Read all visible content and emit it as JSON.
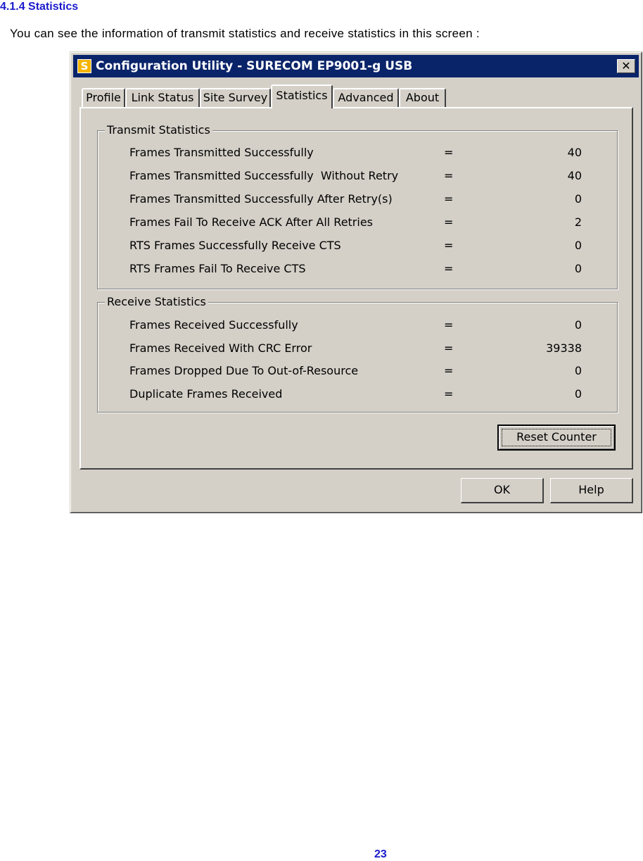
{
  "document": {
    "section_heading": "4.1.4 Statistics",
    "intro": "You can see the information of transmit statistics and receive statistics in this screen :",
    "page_number": "23"
  },
  "window": {
    "title": "Configuration Utility - SURECOM EP9001-g USB",
    "app_icon_glyph": "S",
    "close_glyph": "✕",
    "tabs": [
      {
        "label": "Profile",
        "active": false
      },
      {
        "label": "Link Status",
        "active": false
      },
      {
        "label": "Site Survey",
        "active": false
      },
      {
        "label": "Statistics",
        "active": true
      },
      {
        "label": "Advanced",
        "active": false
      },
      {
        "label": "About",
        "active": false
      }
    ],
    "transmit": {
      "legend": "Transmit Statistics",
      "rows": [
        {
          "label": "Frames Transmitted Successfully",
          "eq": "=",
          "value": "40"
        },
        {
          "label": "Frames Transmitted Successfully  Without Retry",
          "eq": "=",
          "value": "40"
        },
        {
          "label": "Frames Transmitted Successfully After Retry(s)",
          "eq": "=",
          "value": "0"
        },
        {
          "label": "Frames Fail To Receive ACK After All Retries",
          "eq": "=",
          "value": "2"
        },
        {
          "label": "RTS Frames Successfully Receive CTS",
          "eq": "=",
          "value": "0"
        },
        {
          "label": "RTS Frames Fail To Receive CTS",
          "eq": "=",
          "value": "0"
        }
      ]
    },
    "receive": {
      "legend": "Receive Statistics",
      "rows": [
        {
          "label": "Frames Received Successfully",
          "eq": "=",
          "value": "0"
        },
        {
          "label": "Frames Received With CRC Error",
          "eq": "=",
          "value": "39338"
        },
        {
          "label": "Frames Dropped Due To Out-of-Resource",
          "eq": "=",
          "value": "0"
        },
        {
          "label": "Duplicate Frames Received",
          "eq": "=",
          "value": "0"
        }
      ]
    },
    "reset_label": "Reset Counter",
    "ok_label": "OK",
    "help_label": "Help"
  },
  "colors": {
    "heading": "#1a1acc",
    "titlebar": "#0a246a",
    "face": "#d4d0c8"
  }
}
